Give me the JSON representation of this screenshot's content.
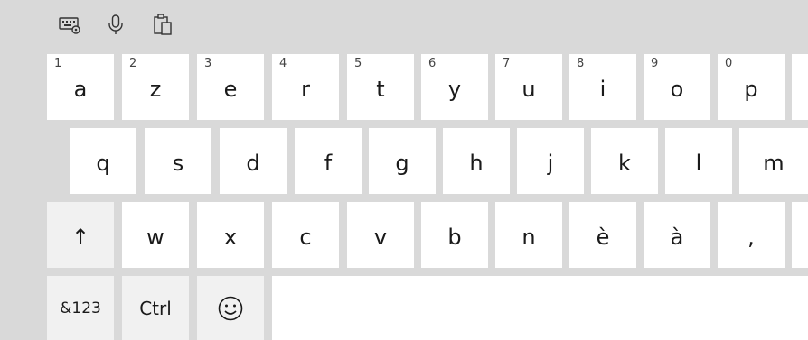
{
  "toolbar": {
    "icons": [
      "keyboard-settings-icon",
      "microphone-icon",
      "clipboard-icon"
    ]
  },
  "row1": [
    {
      "num": "1",
      "label": "a"
    },
    {
      "num": "2",
      "label": "z"
    },
    {
      "num": "3",
      "label": "e"
    },
    {
      "num": "4",
      "label": "r"
    },
    {
      "num": "5",
      "label": "t"
    },
    {
      "num": "6",
      "label": "y"
    },
    {
      "num": "7",
      "label": "u"
    },
    {
      "num": "8",
      "label": "i"
    },
    {
      "num": "9",
      "label": "o"
    },
    {
      "num": "0",
      "label": "p"
    }
  ],
  "row2": [
    "q",
    "s",
    "d",
    "f",
    "g",
    "h",
    "j",
    "k",
    "l",
    "m"
  ],
  "row3": {
    "shift": "↑",
    "letters": [
      "w",
      "x",
      "c",
      "v",
      "b",
      "n",
      "è",
      "à",
      ","
    ]
  },
  "row4": {
    "symbols": "&123",
    "ctrl": "Ctrl",
    "emoji": "☺"
  },
  "colors": {
    "background": "#d9d9d9",
    "key": "#ffffff",
    "function_key": "#f1f1f1"
  }
}
